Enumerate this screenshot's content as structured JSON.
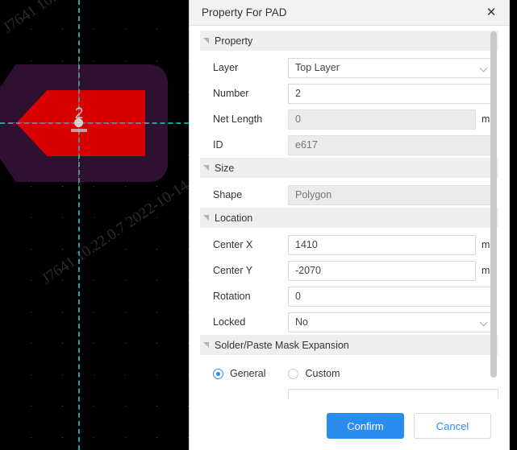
{
  "canvas": {
    "name": "pcb-editor-canvas",
    "background_color": "#000000",
    "pad_number_label": "2",
    "pad_copper_color": "#d80000",
    "pad_mask_color": "#2f1031",
    "guide_color": "#19a3a3",
    "watermark_text": "J7641 10.22.0.7 2022-10-14"
  },
  "dialog": {
    "title": "Property For PAD",
    "close_icon": "close-icon",
    "accent_color": "#2b8cf0",
    "groups": [
      {
        "key": "property",
        "label": "Property",
        "collapse_icon": "collapse-triangle-icon",
        "fields": [
          {
            "key": "layer",
            "label": "Layer",
            "type": "select",
            "value": "Top Layer",
            "unit": "",
            "disabled": false,
            "placeholder": ""
          },
          {
            "key": "number",
            "label": "Number",
            "type": "text",
            "value": "2",
            "unit": "",
            "disabled": false,
            "placeholder": ""
          },
          {
            "key": "net_length",
            "label": "Net Length",
            "type": "text",
            "value": "",
            "unit": "mil",
            "disabled": true,
            "placeholder": "0"
          },
          {
            "key": "id",
            "label": "ID",
            "type": "text",
            "value": "",
            "unit": "",
            "disabled": true,
            "placeholder": "e617"
          }
        ]
      },
      {
        "key": "size",
        "label": "Size",
        "collapse_icon": "collapse-triangle-icon",
        "fields": [
          {
            "key": "shape",
            "label": "Shape",
            "type": "text",
            "value": "",
            "unit": "",
            "disabled": true,
            "placeholder": "Polygon"
          }
        ]
      },
      {
        "key": "location",
        "label": "Location",
        "collapse_icon": "collapse-triangle-icon",
        "fields": [
          {
            "key": "center_x",
            "label": "Center X",
            "type": "text",
            "value": "1410",
            "unit": "mil",
            "disabled": false,
            "placeholder": ""
          },
          {
            "key": "center_y",
            "label": "Center Y",
            "type": "text",
            "value": "-2070",
            "unit": "mil",
            "disabled": false,
            "placeholder": ""
          },
          {
            "key": "rotation",
            "label": "Rotation",
            "type": "text",
            "value": "0",
            "unit": "",
            "disabled": false,
            "placeholder": ""
          },
          {
            "key": "locked",
            "label": "Locked",
            "type": "select",
            "value": "No",
            "unit": "",
            "disabled": false,
            "placeholder": ""
          }
        ]
      },
      {
        "key": "solder_paste_mask_expansion",
        "label": "Solder/Paste Mask Expansion",
        "collapse_icon": "collapse-triangle-icon",
        "fields": []
      }
    ],
    "mask_expansion": {
      "options": [
        {
          "key": "general",
          "label": "General",
          "selected": true
        },
        {
          "key": "custom",
          "label": "Custom",
          "selected": false
        }
      ]
    },
    "footer": {
      "confirm_label": "Confirm",
      "cancel_label": "Cancel"
    }
  }
}
